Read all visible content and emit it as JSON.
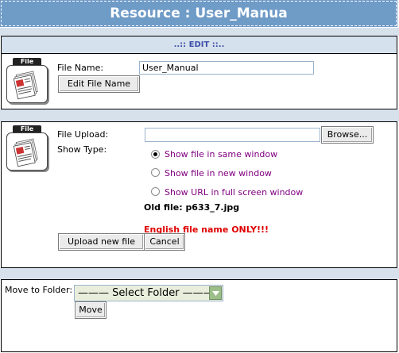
{
  "title": "Resource : User_Manua",
  "edit_header": "..:: EDIT ::..",
  "icon_tag": "File",
  "edit_section": {
    "file_name_label": "File Name:",
    "file_name_value": "User_Manual",
    "edit_button": "Edit File Name"
  },
  "upload_section": {
    "file_upload_label": "File Upload:",
    "browse_button": "Browse...",
    "show_type_label": "Show Type:",
    "options": [
      {
        "label": "Show file in same window",
        "selected": true
      },
      {
        "label": "Show file in new window",
        "selected": false
      },
      {
        "label": "Show URL in full screen window",
        "selected": false
      }
    ],
    "old_file": "Old file: p633_7.jpg",
    "warning": "English file name ONLY!!!",
    "upload_button": "Upload new file",
    "cancel_button": "Cancel"
  },
  "move_section": {
    "label": "Move to Folder:",
    "select_value": "——— Select Folder ———",
    "move_button": "Move"
  }
}
